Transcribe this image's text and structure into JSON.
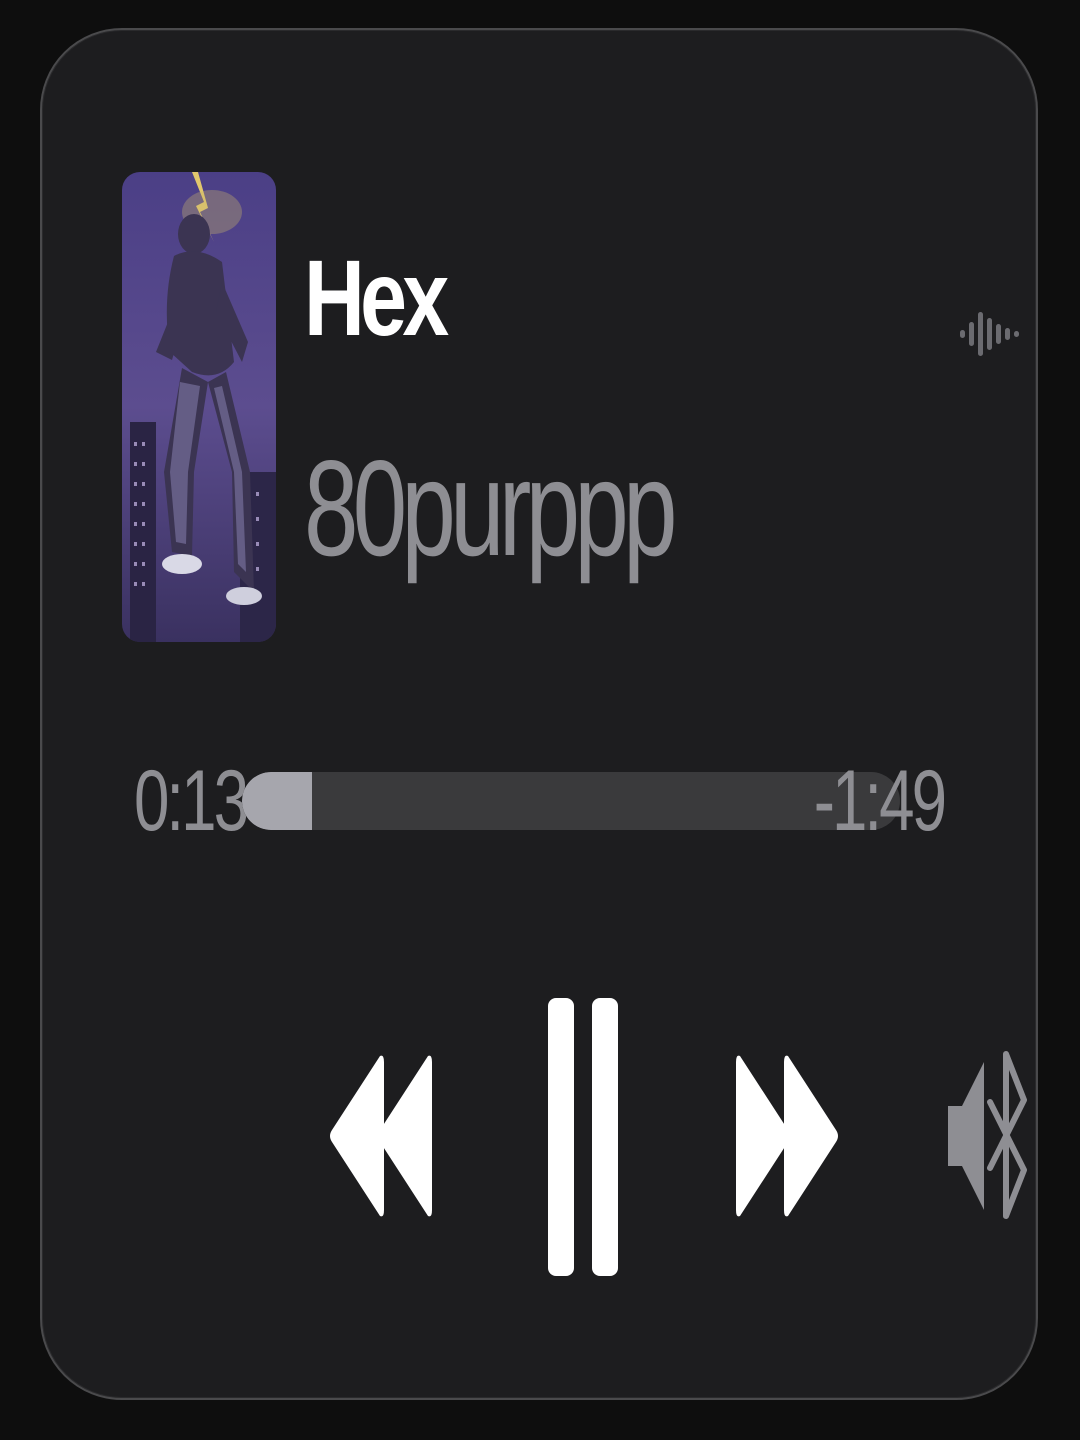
{
  "track": {
    "title": "Hex",
    "artist": "80purppp"
  },
  "playback": {
    "elapsed": "0:13",
    "remaining": "-1:49",
    "progress_fraction": 0.107,
    "state": "playing"
  },
  "icons": {
    "album_art": "album-art-image",
    "waveform": "waveform-icon",
    "rewind": "rewind-icon",
    "pause": "pause-icon",
    "forward": "fast-forward-icon",
    "audio_output": "speaker-bluetooth-icon"
  },
  "colors": {
    "background": "#1d1d1f",
    "title": "#ffffff",
    "secondary_text": "#8e8e93",
    "progress_fill": "#a6a6ad",
    "progress_track": "#3a3a3c",
    "controls": "#ffffff"
  }
}
